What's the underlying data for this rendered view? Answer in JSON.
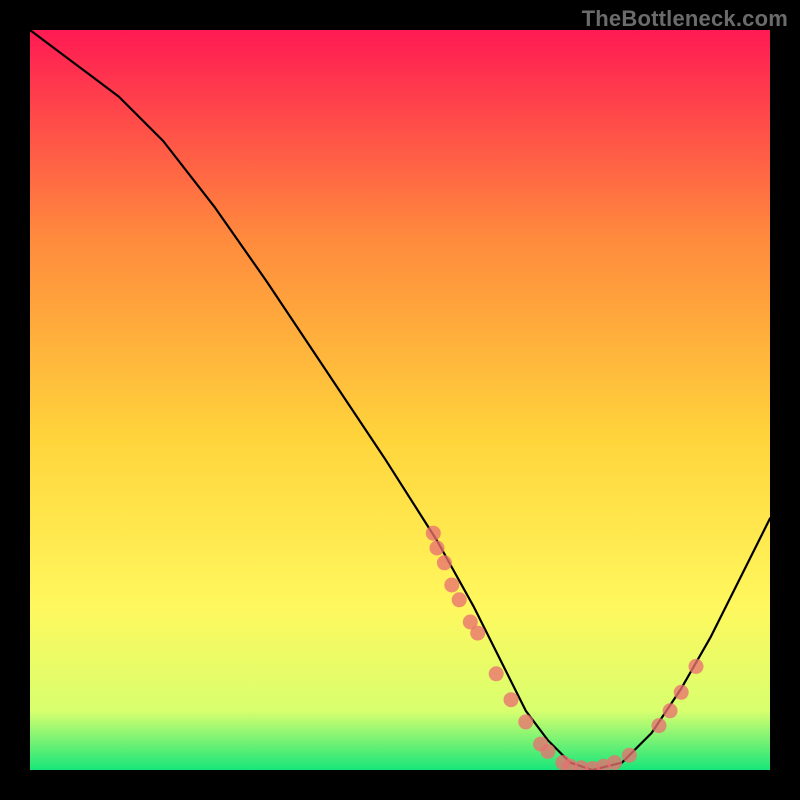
{
  "watermark": "TheBottleneck.com",
  "gradient": {
    "top": "#ff1a53",
    "upper_mid": "#ff8a3d",
    "mid": "#ffd43b",
    "lower_mid": "#fff85e",
    "lower": "#d8ff6e",
    "bottom": "#17e67a"
  },
  "curve_color": "#000000",
  "dot_color": "#e97171",
  "chart_data": {
    "type": "line",
    "title": "",
    "xlabel": "",
    "ylabel": "",
    "xlim": [
      0,
      100
    ],
    "ylim": [
      0,
      100
    ],
    "grid": false,
    "series": [
      {
        "name": "bottleneck-curve",
        "x": [
          0,
          4,
          8,
          12,
          18,
          25,
          32,
          40,
          48,
          55,
          60,
          64,
          67,
          70,
          73,
          76,
          80,
          84,
          88,
          92,
          96,
          100
        ],
        "y": [
          100,
          97,
          94,
          91,
          85,
          76,
          66,
          54,
          42,
          31,
          22,
          14,
          8,
          4,
          1,
          0,
          1,
          5,
          11,
          18,
          26,
          34
        ]
      }
    ],
    "data_points": {
      "name": "measured-points",
      "x": [
        54.5,
        55.0,
        56.0,
        57.0,
        58.0,
        59.5,
        60.5,
        63.0,
        65.0,
        67.0,
        69.0,
        70.0,
        72.0,
        73.0,
        74.5,
        76.0,
        77.5,
        79.0,
        81.0,
        85.0,
        86.5,
        88.0,
        90.0
      ],
      "y": [
        32.0,
        30.0,
        28.0,
        25.0,
        23.0,
        20.0,
        18.5,
        13.0,
        9.5,
        6.5,
        3.5,
        2.5,
        1.0,
        0.5,
        0.3,
        0.2,
        0.5,
        1.0,
        2.0,
        6.0,
        8.0,
        10.5,
        14.0
      ]
    }
  }
}
